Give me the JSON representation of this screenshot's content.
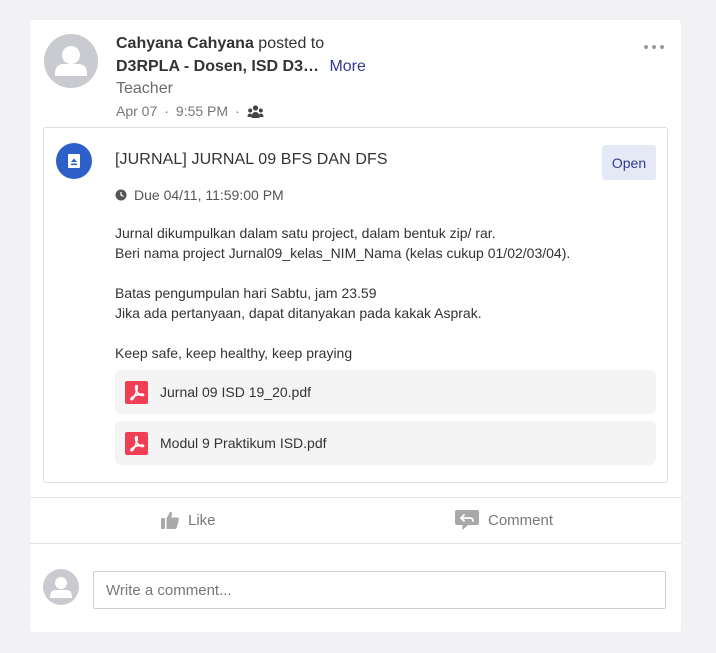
{
  "post": {
    "author": "Cahyana Cahyana",
    "posted_to_text": "posted to",
    "groups_text": "D3RPLA - Dosen,  ISD D3…",
    "more_label": "More",
    "role": "Teacher",
    "date": "Apr 07",
    "time": "9:55 PM",
    "dot": "·",
    "icons": {
      "avatar": "user-avatar-icon",
      "audience": "group-audience-icon",
      "menu": "kebab-menu-icon"
    }
  },
  "assignment": {
    "title": "[JURNAL] JURNAL 09 BFS DAN DFS",
    "open_label": "Open",
    "due": "Due 04/11, 11:59:00 PM",
    "description": {
      "line1": "Jurnal dikumpulkan dalam satu project, dalam bentuk zip/ rar.",
      "line2": "Beri nama project Jurnal09_kelas_NIM_Nama (kelas cukup 01/02/03/04).",
      "line3": "Batas pengumpulan hari Sabtu, jam 23.59",
      "line4": "Jika ada pertanyaan, dapat ditanyakan pada kakak Asprak.",
      "line5": "Keep safe, keep healthy, keep praying"
    },
    "files": [
      {
        "name": "Jurnal 09 ISD 19_20.pdf",
        "icon": "pdf-icon"
      },
      {
        "name": "Modul 9 Praktikum ISD.pdf",
        "icon": "pdf-icon"
      }
    ],
    "icon": "assignment-icon"
  },
  "actions": {
    "like_label": "Like",
    "comment_label": "Comment"
  },
  "comment": {
    "placeholder": "Write a comment..."
  },
  "colors": {
    "accent": "#2d5fc9",
    "link": "#2f3b93",
    "pdf": "#f03e55",
    "background": "#f2f2f4"
  }
}
